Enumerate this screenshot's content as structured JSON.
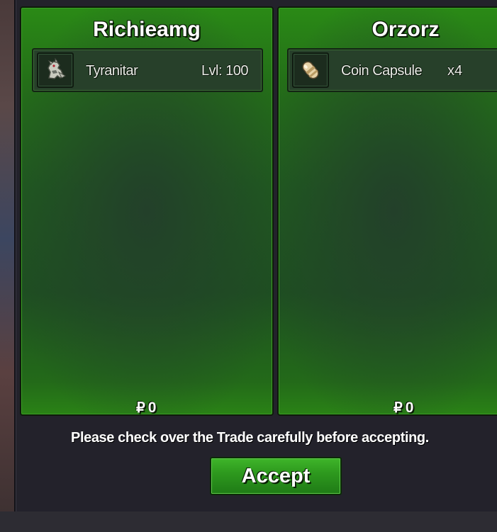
{
  "trade": {
    "left_player": {
      "name": "Richieamg",
      "item": {
        "icon": "tyranitar-sprite-icon",
        "name": "Tyranitar",
        "level": "Lvl: 100"
      },
      "money_sign": "₽",
      "money": "0"
    },
    "right_player": {
      "name": "Orzorz",
      "item": {
        "icon": "coin-capsule-icon",
        "name": "Coin Capsule",
        "quantity": "x4"
      },
      "money_sign": "₽",
      "money": "0"
    },
    "notice": "Please check over the Trade carefully before accepting.",
    "accept_label": "Accept"
  },
  "colors": {
    "panel_green": "#2a8216",
    "dialog_bg": "#23222b",
    "button_green": "#2e9a1e"
  }
}
